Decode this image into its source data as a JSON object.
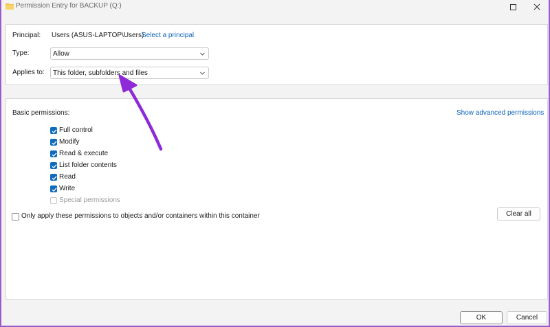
{
  "window": {
    "title": "Permission Entry for BACKUP (Q:)",
    "folder_icon_color": "#f4c244"
  },
  "principal": {
    "label": "Principal:",
    "value": "Users (ASUS-LAPTOP\\Users)",
    "select_link": "Select a principal"
  },
  "type": {
    "label": "Type:",
    "value": "Allow"
  },
  "applies_to": {
    "label": "Applies to:",
    "value": "This folder, subfolders and files"
  },
  "permissions": {
    "label": "Basic permissions:",
    "advanced_link": "Show advanced permissions",
    "items": [
      {
        "label": "Full control",
        "checked": true,
        "enabled": true
      },
      {
        "label": "Modify",
        "checked": true,
        "enabled": true
      },
      {
        "label": "Read & execute",
        "checked": true,
        "enabled": true
      },
      {
        "label": "List folder contents",
        "checked": true,
        "enabled": true
      },
      {
        "label": "Read",
        "checked": true,
        "enabled": true
      },
      {
        "label": "Write",
        "checked": true,
        "enabled": true
      },
      {
        "label": "Special permissions",
        "checked": false,
        "enabled": false
      }
    ],
    "apply_only_label": "Only apply these permissions to objects and/or containers within this container",
    "apply_only_checked": false,
    "clear_all_label": "Clear all"
  },
  "footer": {
    "ok_label": "OK",
    "cancel_label": "Cancel"
  },
  "colors": {
    "accent": "#0f6cbd",
    "link": "#0b63ba",
    "annotation_arrow": "#8e2ad6",
    "window_border": "#9b59d0"
  }
}
